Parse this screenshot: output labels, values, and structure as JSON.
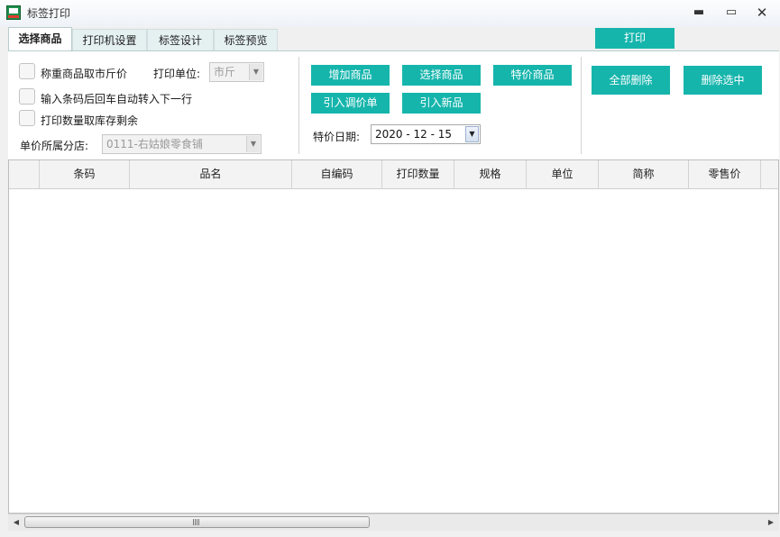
{
  "window": {
    "title": "标签打印",
    "minimize": "▬",
    "maximize": "▭",
    "close": "✕"
  },
  "tabs": [
    "选择商品",
    "打印机设置",
    "标签设计",
    "标签预览"
  ],
  "print_button": "打印",
  "options": {
    "weigh_unit_checkbox": "称重商品取市斤价",
    "auto_next_checkbox": "输入条码后回车自动转入下一行",
    "stock_remain_checkbox": "打印数量取库存剩余",
    "print_unit_label": "打印单位:",
    "print_unit_value": "市斤",
    "store_label": "单价所属分店:",
    "store_value": "0111-右姑娘零食铺"
  },
  "actions": {
    "add": "增加商品",
    "select": "选择商品",
    "special": "特价商品",
    "import_price": "引入调价单",
    "import_new": "引入新品",
    "special_date_label": "特价日期:",
    "special_date_value": "2020 - 12 - 15"
  },
  "delete_all": "全部删除",
  "delete_selected": "删除选中",
  "columns": [
    "条码",
    "品名",
    "自编码",
    "打印数量",
    "规格",
    "单位",
    "简称",
    "零售价"
  ],
  "scrollbar": {
    "left_arrow": "◀",
    "right_arrow": "▶"
  },
  "colors": {
    "accent": "#16b5ac"
  }
}
